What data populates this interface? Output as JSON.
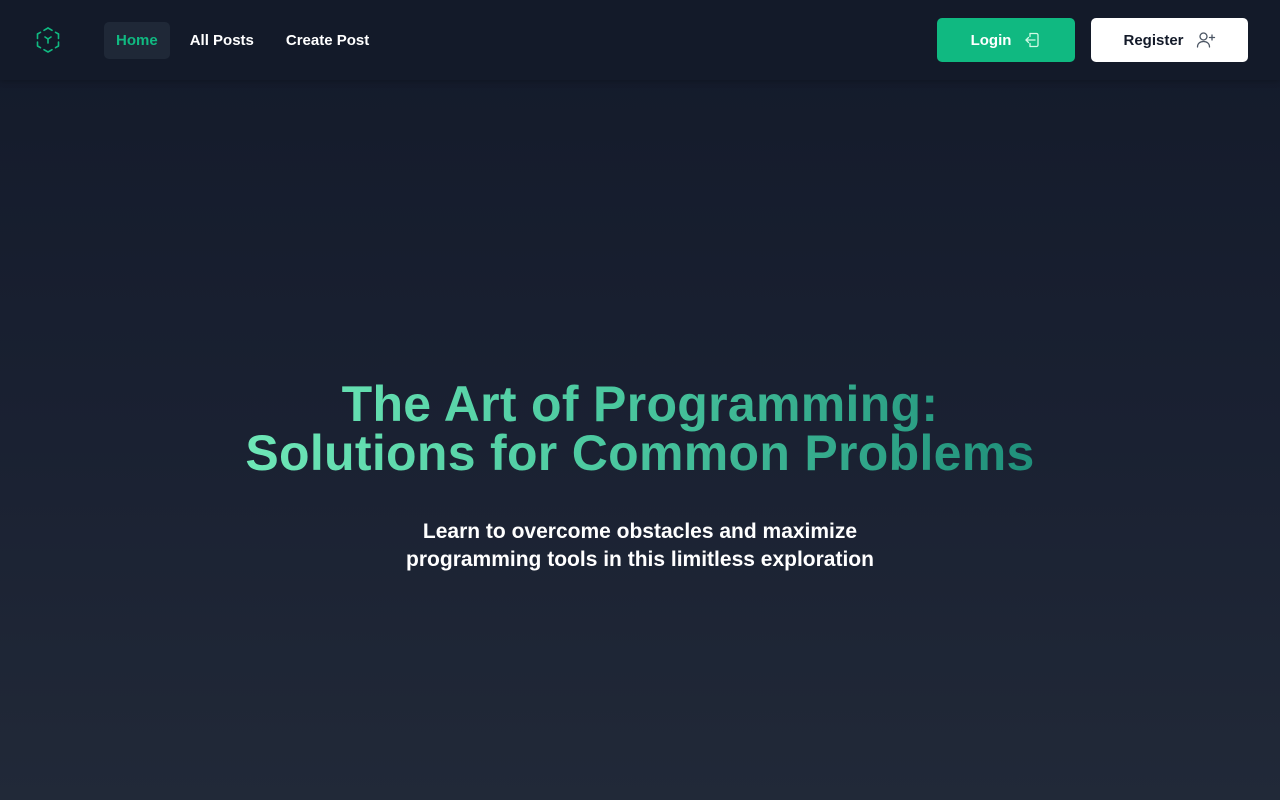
{
  "nav": {
    "logo_icon": "cube-logo-icon",
    "links": [
      {
        "label": "Home",
        "active": true
      },
      {
        "label": "All Posts",
        "active": false
      },
      {
        "label": "Create Post",
        "active": false
      }
    ],
    "login_label": "Login",
    "login_icon": "login-arrow-icon",
    "register_label": "Register",
    "register_icon": "user-plus-icon"
  },
  "hero": {
    "title_line1": "The Art of Programming:",
    "title_line2": "Solutions for Common Problems",
    "subtitle_line1": "Learn to overcome obstacles and maximize",
    "subtitle_line2": "programming tools in this limitless exploration"
  },
  "colors": {
    "accent": "#10b981",
    "title_gradient_start": "#6ee7b7",
    "title_gradient_end": "#1f8f7a",
    "navbar_bg": "#131a29",
    "page_bg_top": "#131a2a",
    "page_bg_bottom": "#212938"
  }
}
